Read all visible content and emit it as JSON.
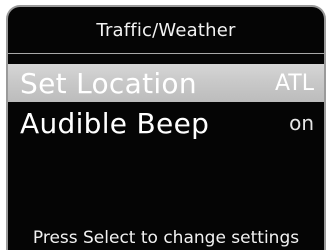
{
  "screen": {
    "title": "Traffic/Weather",
    "items": [
      {
        "label": "Set Location",
        "value": "ATL",
        "selected": true
      },
      {
        "label": "Audible Beep",
        "value": "on",
        "selected": false
      }
    ],
    "hint": "Press Select to change settings"
  }
}
